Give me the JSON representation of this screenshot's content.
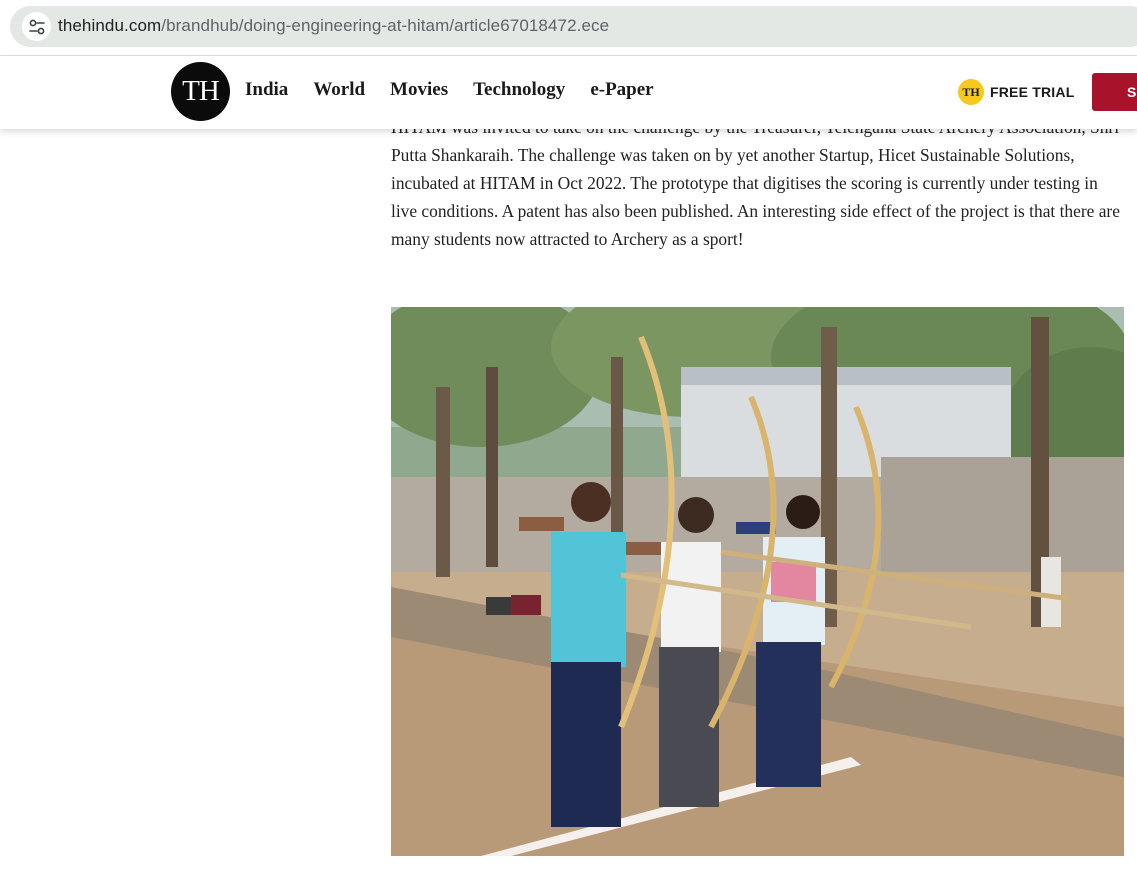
{
  "browser": {
    "url_domain": "thehindu.com",
    "url_path": "/brandhub/doing-engineering-at-hitam/article67018472.ece",
    "site_info_icon": "tune-icon"
  },
  "header": {
    "logo_text": "TH",
    "nav": [
      {
        "label": "India"
      },
      {
        "label": "World"
      },
      {
        "label": "Movies"
      },
      {
        "label": "Technology"
      },
      {
        "label": "e-Paper"
      }
    ],
    "free_trial_badge": "TH",
    "free_trial_label": "FREE TRIAL",
    "subscribe_label": "SUBSCRIBE",
    "subscribe_color": "#a8122a"
  },
  "article": {
    "paragraph": "HITAM was invited to take on the challenge by the Treasurer, Telengana State Archery Association, Shri Putta Shankaraih. The challenge was taken on by yet another Startup, Hicet Sustainable Solutions, incubated at HITAM in Oct 2022. The prototype that digitises the scoring is currently under testing in live conditions. A patent has also been published. An interesting side effect of the project is that there are many students now attracted to Archery as a sport!"
  }
}
